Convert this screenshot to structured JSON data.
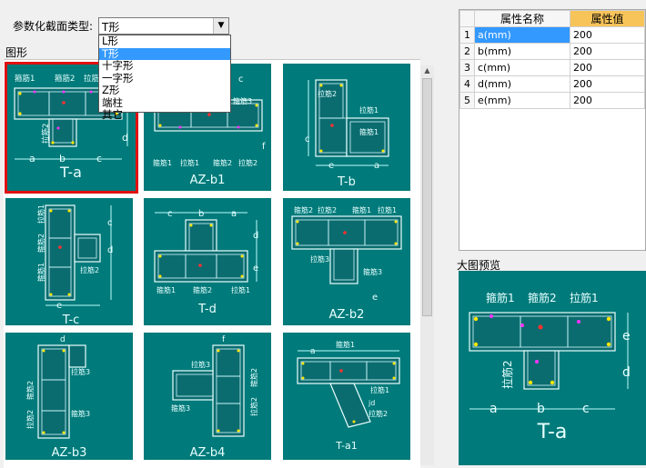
{
  "window": {
    "type_label": "参数化截面类型:",
    "shape_group_label": "图形",
    "preview_label": "大图预览"
  },
  "combo": {
    "selected": "T形",
    "options": [
      "L形",
      "T形",
      "十字形",
      "一字形",
      "Z形",
      "端柱",
      "其它"
    ],
    "active_index": 1
  },
  "tiles": [
    {
      "label": "T-a",
      "selected": true
    },
    {
      "label": "AZ-b1",
      "selected": false
    },
    {
      "label": "T-b",
      "selected": false
    },
    {
      "label": "T-c",
      "selected": false
    },
    {
      "label": "T-d",
      "selected": false
    },
    {
      "label": "AZ-b2",
      "selected": false
    },
    {
      "label": "AZ-b3",
      "selected": false
    },
    {
      "label": "AZ-b4",
      "selected": false
    },
    {
      "label": "T-a1",
      "selected": false
    }
  ],
  "tile_text": {
    "ta": {
      "g1": "箍筋1",
      "g2": "箍筋2",
      "l1": "拉筋1",
      "l2": "拉筋2",
      "a": "a",
      "b": "b",
      "c": "c",
      "d": "d",
      "e": "e"
    },
    "azb1": {
      "g1": "箍筋1",
      "l1": "拉筋1",
      "g2": "箍筋2",
      "l2": "拉筋2",
      "g3": "箍筋3",
      "c": "c",
      "f": "f"
    },
    "tb": {
      "l1": "拉筋1",
      "l2": "拉筋2",
      "g1": "箍筋1",
      "e": "e",
      "c": "c",
      "a": "a"
    },
    "tc": {
      "l1": "拉筋1",
      "g1": "箍筋1",
      "l2": "拉筋2",
      "g2": "箍筋2",
      "e": "e",
      "d": "d",
      "c": "c"
    },
    "td": {
      "c": "c",
      "b": "b",
      "a": "a",
      "d": "d",
      "e": "e",
      "g1": "箍筋1",
      "g2": "箍筋2",
      "l1": "拉筋1"
    },
    "azb2": {
      "g2": "箍筋2",
      "l2": "拉筋2",
      "g1": "箍筋1",
      "l1": "拉筋1",
      "g3": "箍筋3",
      "l3": "拉筋3",
      "e": "e"
    },
    "azb3": {
      "d": "d",
      "l3": "拉筋3",
      "g2": "箍筋2",
      "g3": "箍筋3",
      "l2": "拉筋2"
    },
    "azb4": {
      "f": "f",
      "l3": "拉筋3",
      "g3": "箍筋3",
      "g2": "箍筋2",
      "l2": "拉筋2"
    },
    "ta1": {
      "a": "a",
      "g1": "箍筋1",
      "l1": "拉筋1",
      "jd": "jd",
      "l2": "拉筋2"
    }
  },
  "grid": {
    "headers": [
      "属性名称",
      "属性值"
    ],
    "rows": [
      {
        "index": "1",
        "name": "a(mm)",
        "value": "200"
      },
      {
        "index": "2",
        "name": "b(mm)",
        "value": "200"
      },
      {
        "index": "3",
        "name": "c(mm)",
        "value": "200"
      },
      {
        "index": "4",
        "name": "d(mm)",
        "value": "200"
      },
      {
        "index": "5",
        "name": "e(mm)",
        "value": "200"
      }
    ]
  },
  "preview": {
    "label": "T-a",
    "g1": "箍筋1",
    "g2": "箍筋2",
    "l1": "拉筋1",
    "l2": "拉筋2",
    "a": "a",
    "b": "b",
    "c": "c",
    "d": "d",
    "e": "e"
  },
  "colors": {
    "teal": "#007a7a",
    "selected_border": "#e01010",
    "highlight": "#3399ff",
    "header_value": "#f7c45a"
  }
}
